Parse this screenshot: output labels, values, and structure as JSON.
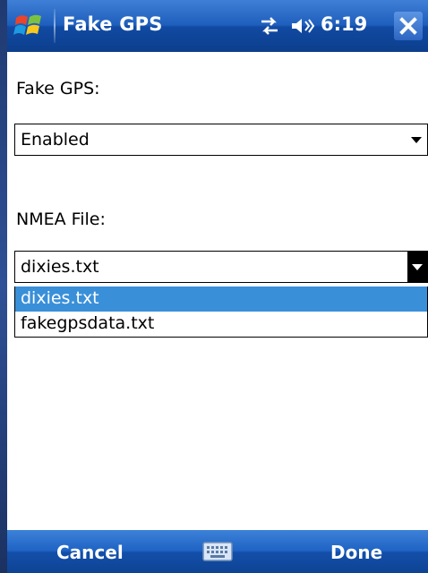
{
  "titlebar": {
    "app_title": "Fake GPS",
    "time": "6:19",
    "close_label": "✕",
    "icons": [
      "windows-start-icon",
      "sync-icon",
      "speaker-icon"
    ]
  },
  "form": {
    "fake_gps_label": "Fake GPS:",
    "fake_gps_value": "Enabled",
    "nmea_label": "NMEA File:",
    "nmea_value": "dixies.txt",
    "nmea_options": [
      "dixies.txt",
      "fakegpsdata.txt"
    ],
    "nmea_selected_index": 0
  },
  "menubar": {
    "left_softkey": "Cancel",
    "right_softkey": "Done",
    "center_icon": "keyboard-icon"
  },
  "colors": {
    "titlebar_blue": "#1f5fbd",
    "selection_blue": "#3a8fd9",
    "background": "#ffffff"
  }
}
